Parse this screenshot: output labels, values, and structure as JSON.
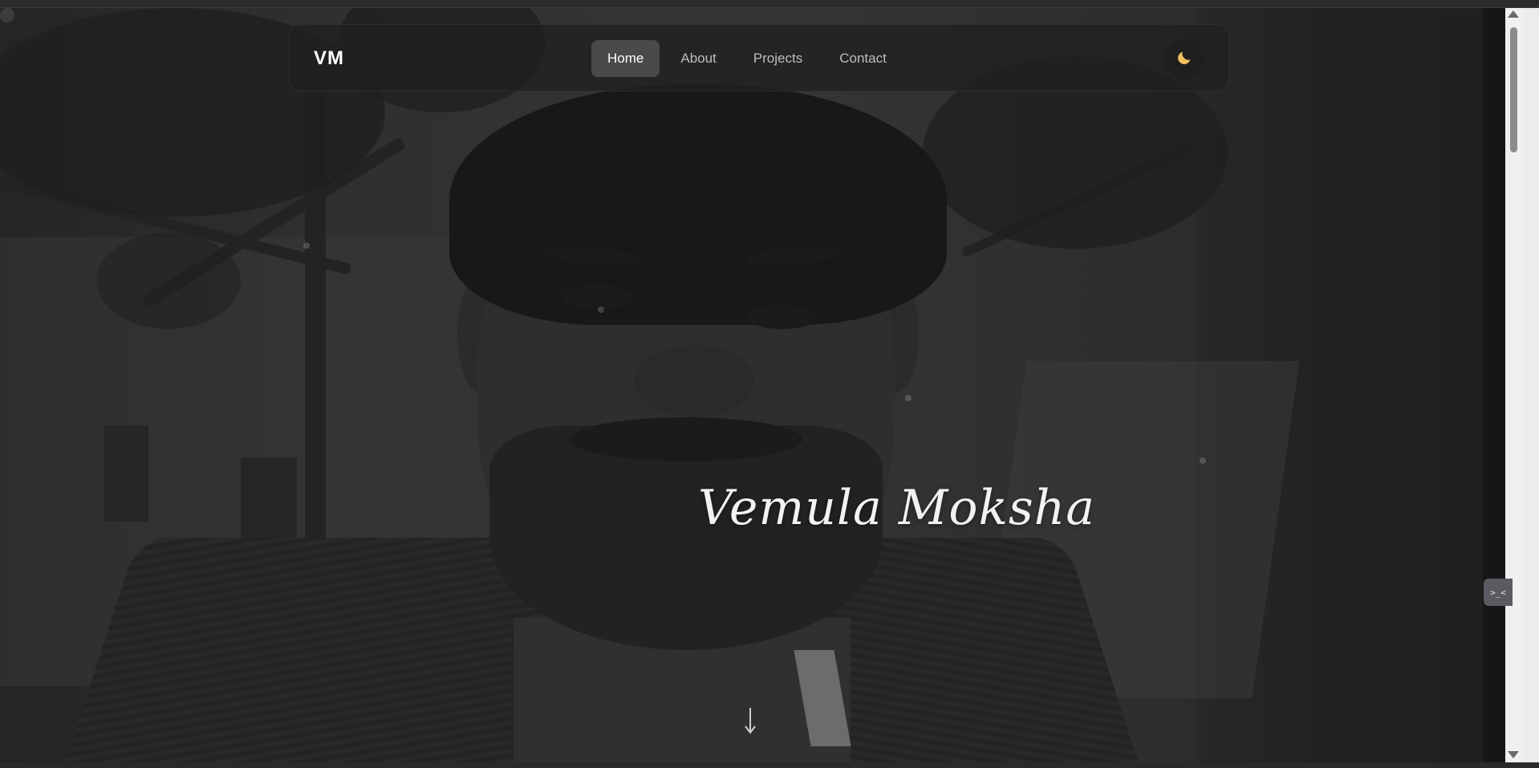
{
  "nav": {
    "logo": "VM",
    "links": [
      {
        "label": "Home",
        "active": true
      },
      {
        "label": "About",
        "active": false
      },
      {
        "label": "Projects",
        "active": false
      },
      {
        "label": "Contact",
        "active": false
      }
    ],
    "theme_toggle_icon": "moon-icon"
  },
  "hero": {
    "name": "Vemula Moksha",
    "scroll_icon": "down-arrow-icon"
  },
  "dev_widget": {
    "icon": "dev-tools-icon",
    "label": ">_<"
  },
  "colors": {
    "nav_active_bg": "#4a4a4a",
    "moon": "#f2c060",
    "text_primary": "#ffffff",
    "text_muted": "#bdbdbd"
  }
}
